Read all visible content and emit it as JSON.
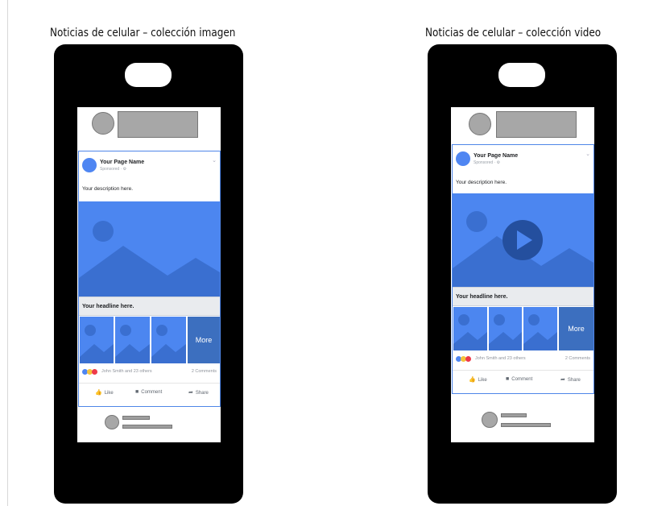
{
  "mockups": [
    {
      "caption": "Noticias de celular – colección imagen",
      "post": {
        "page_name": "Your Page Name",
        "sponsored": "Sponsored · ⚙",
        "description": "Your description here.",
        "headline": "Your headline here.",
        "more_label": "More",
        "reactors": "John Smith and 23 others",
        "comments": "2 Comments",
        "like_label": "Like",
        "comment_label": "Comment",
        "share_label": "Share"
      }
    },
    {
      "caption": "Noticias de celular – colección video",
      "post": {
        "page_name": "Your Page Name",
        "sponsored": "Sponsored · ⚙",
        "description": "Your description here.",
        "headline": "Your headline here.",
        "more_label": "More",
        "reactors": "John Smith and 23 others",
        "comments": "2 Comments",
        "like_label": "Like",
        "comment_label": "Comment",
        "share_label": "Share"
      }
    }
  ],
  "icons": {
    "chevron": "chevron-down-icon",
    "play": "play-icon",
    "like": "thumbs-up-icon",
    "comment": "comment-icon",
    "share": "share-arrow-icon",
    "reactions": [
      "like-reaction-icon",
      "wow-reaction-icon",
      "love-reaction-icon"
    ]
  },
  "colors": {
    "phone": "#000000",
    "media_blue": "#4c86f0",
    "more_blue": "#3c6fbf",
    "post_border": "#4f86e8",
    "placeholder_gray": "#a7a7a7"
  }
}
